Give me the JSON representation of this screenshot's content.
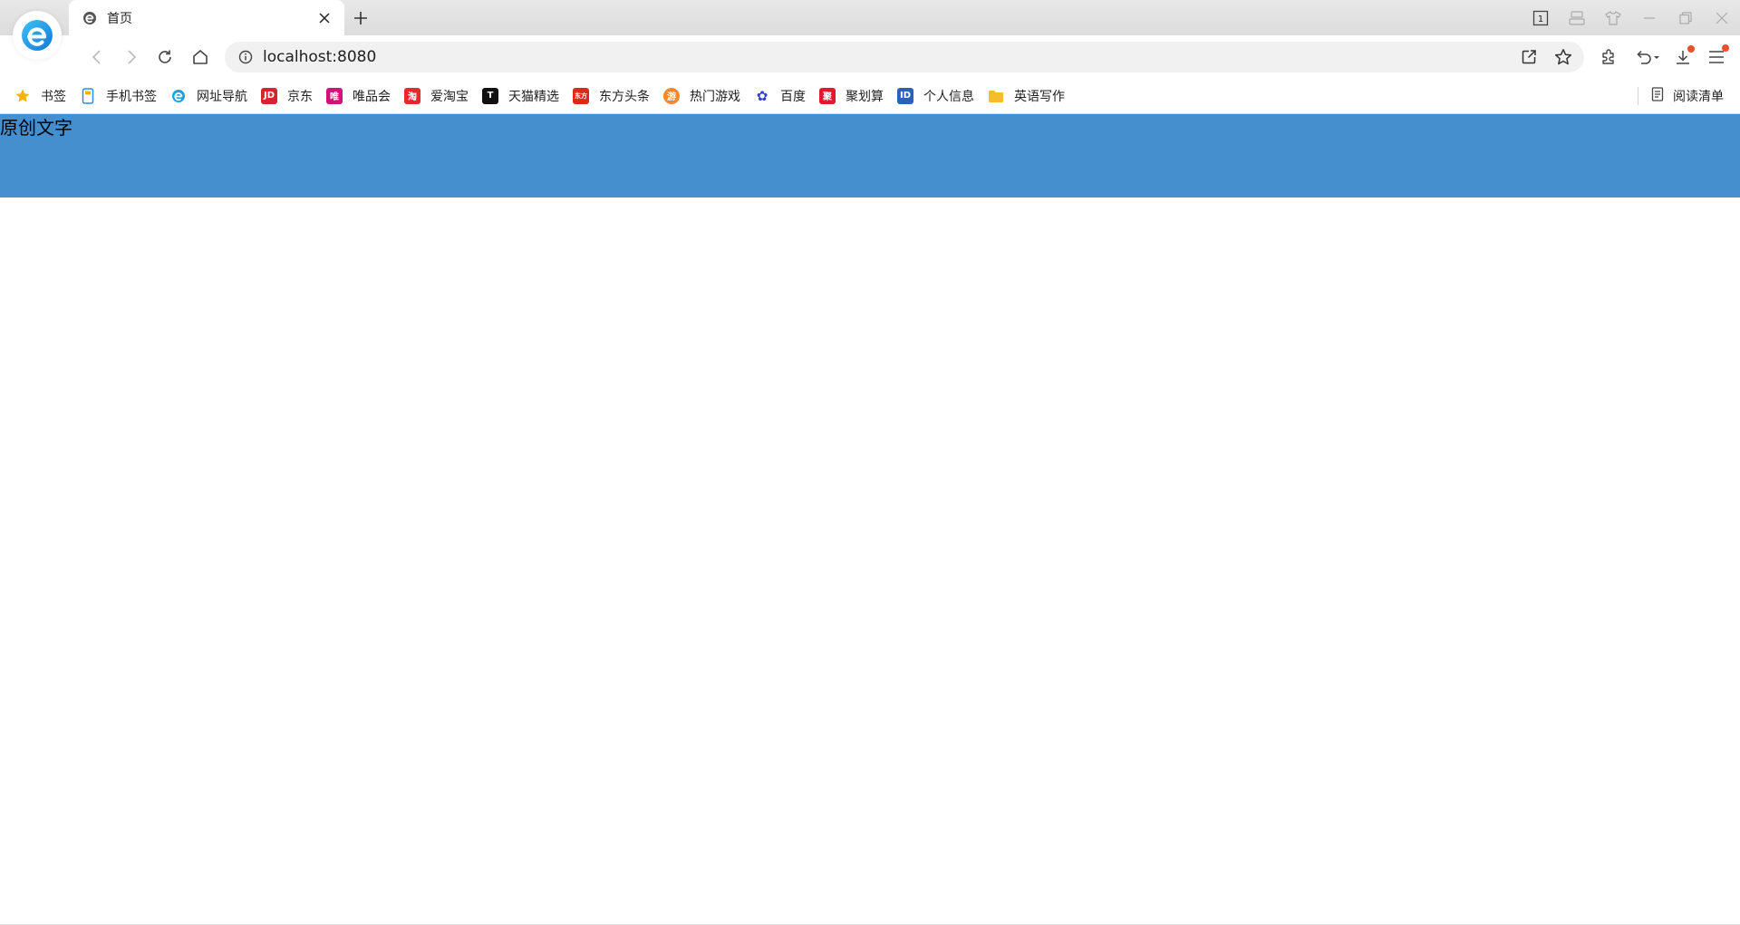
{
  "browser": {
    "tab_title": "首页",
    "address_url": "localhost:8080",
    "accent_color": "#1aa1e8"
  },
  "window_controls": [
    "tab-count-icon",
    "profile-icon",
    "skin-icon",
    "minimize-icon",
    "restore-icon",
    "close-icon"
  ],
  "tab_count": "1",
  "bookmarks": [
    {
      "label": "书签",
      "icon": "star-icon",
      "color": "#f5b400"
    },
    {
      "label": "手机书签",
      "icon": "phone-icon",
      "color": "#2a8cf0"
    },
    {
      "label": "网址导航",
      "icon": "edge-icon",
      "color": "#1aa1e8"
    },
    {
      "label": "京东",
      "icon": "jd-icon",
      "color": "#d7232d",
      "glyph": "JD"
    },
    {
      "label": "唯品会",
      "icon": "vip-icon",
      "color": "#d1127a",
      "glyph": "唯"
    },
    {
      "label": "爱淘宝",
      "icon": "taobao-icon",
      "color": "#e8272f",
      "glyph": "淘"
    },
    {
      "label": "天猫精选",
      "icon": "tmall-icon",
      "color": "#111111",
      "glyph": "T"
    },
    {
      "label": "东方头条",
      "icon": "eastday-icon",
      "color": "#e3261c",
      "glyph": "东方"
    },
    {
      "label": "热门游戏",
      "icon": "game-icon",
      "color": "#f7882f",
      "glyph": "游"
    },
    {
      "label": "百度",
      "icon": "baidu-paw-icon",
      "color": "#2f3fd4",
      "glyph": "✿"
    },
    {
      "label": "聚划算",
      "icon": "juhuasuan-icon",
      "color": "#e6162d",
      "glyph": "聚"
    },
    {
      "label": "个人信息",
      "icon": "profile-card-icon",
      "color": "#2b62b8",
      "glyph": "ID"
    },
    {
      "label": "英语写作",
      "icon": "folder-icon",
      "color": "#f5bd2b"
    }
  ],
  "reading_list_label": "阅读清单",
  "page": {
    "header_text": "原创文字",
    "header_color": "#458fce"
  }
}
